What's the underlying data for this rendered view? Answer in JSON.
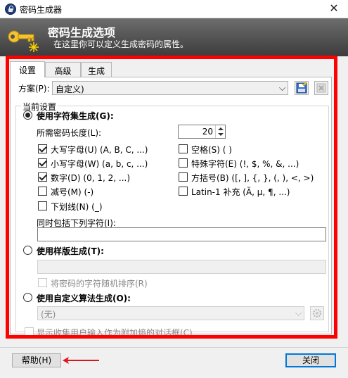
{
  "window": {
    "title": "密码生成器"
  },
  "banner": {
    "title": "密码生成选项",
    "subtitle": "在这里你可以定义生成密码的属性。"
  },
  "tabs": [
    {
      "label": "设置"
    },
    {
      "label": "高级"
    },
    {
      "label": "生成"
    }
  ],
  "profile": {
    "label": "方案(P):",
    "value": "自定义)"
  },
  "group": {
    "title": "当前设置"
  },
  "charset": {
    "label": "使用字符集生成(G):",
    "length_label": "所需密码长度(L):",
    "length_value": "20",
    "options": {
      "upper": "大写字母(U) (A, B, C, ...)",
      "lower": "小写字母(W) (a, b, c, ...)",
      "digits": "数字(D) (0, 1, 2, ...)",
      "minus": "减号(M) (-)",
      "underline": "下划线(N) (_)",
      "space": "空格(S) ( )",
      "special": "特殊字符(E) (!, $, %, &, ...)",
      "brackets": "方括号(B) ([, ], {, }, (, ), <, >)",
      "latin1": "Latin-1 补充 (Ä, µ, ¶, ...)"
    },
    "also_include_label": "同时包括下列字符(I):"
  },
  "pattern": {
    "label": "使用样版生成(T):",
    "permute_label": "将密码的字符随机排序(R)"
  },
  "custom": {
    "label": "使用自定义算法生成(O):",
    "value": "(无)"
  },
  "entropy_label": "显示收集用户输入作为附加熵的对话框(C)",
  "buttons": {
    "help": "帮助(H)",
    "close": "关闭"
  },
  "colors": {
    "highlight": "#ff0000",
    "arrow": "#e0141e",
    "banner_top": "#6d6d6d",
    "banner_bottom": "#3c3c3c"
  }
}
